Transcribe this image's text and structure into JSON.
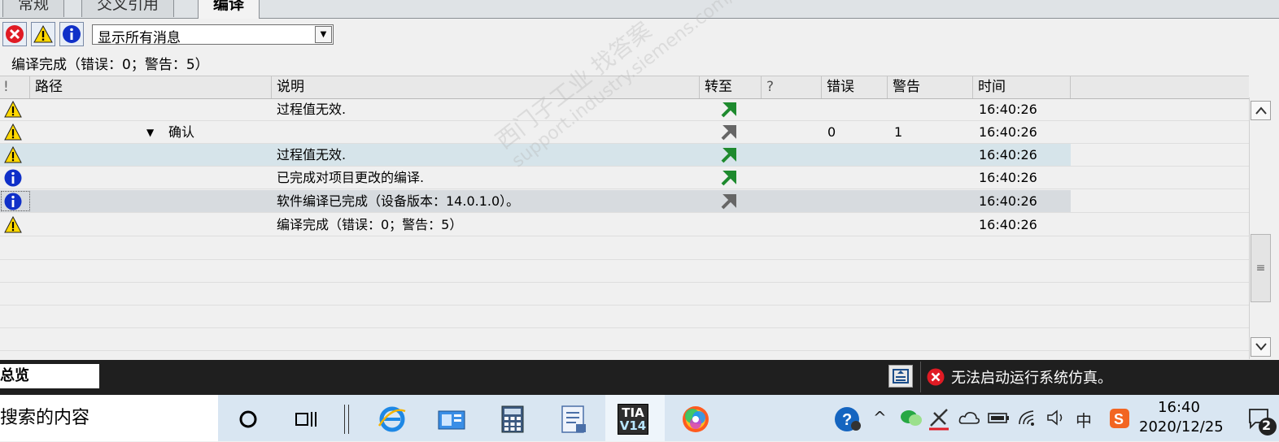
{
  "tabs": [
    {
      "label": "常规"
    },
    {
      "label": "交叉引用"
    },
    {
      "label": "编译"
    }
  ],
  "filter": {
    "selected": "显示所有消息"
  },
  "summary": "编译完成（错误：0；警告：5）",
  "columns": {
    "flag": "!",
    "path": "路径",
    "desc": "说明",
    "goto": "转至",
    "q": "?",
    "errors": "错误",
    "warnings": "警告",
    "time": "时间"
  },
  "rows": [
    {
      "icon": "warning-icon",
      "path": "",
      "desc": "过程值无效.",
      "goto": "green",
      "errors": "",
      "warnings": "",
      "time": "16:40:26"
    },
    {
      "icon": "warning-icon",
      "path": "确认",
      "desc": "",
      "goto": "gray",
      "errors": "0",
      "warnings": "1",
      "time": "16:40:26"
    },
    {
      "icon": "warning-icon",
      "path": "",
      "desc": "过程值无效.",
      "goto": "green",
      "errors": "",
      "warnings": "",
      "time": "16:40:26"
    },
    {
      "icon": "info-icon",
      "path": "",
      "desc": "已完成对项目更改的编译.",
      "goto": "green",
      "errors": "",
      "warnings": "",
      "time": "16:40:26"
    },
    {
      "icon": "info-icon",
      "path": "",
      "desc": "软件编译已完成（设备版本：14.0.1.0）。",
      "goto": "gray",
      "errors": "",
      "warnings": "",
      "time": "16:40:26"
    },
    {
      "icon": "warning-icon",
      "path": "",
      "desc": "编译完成（错误：0；警告：5）",
      "goto": "",
      "errors": "",
      "warnings": "",
      "time": "16:40:26"
    }
  ],
  "watermark": {
    "line1": "西门子工业 找答案",
    "line2": "support.industry.siemens.com/cs"
  },
  "statusbar": {
    "overview": "总览",
    "message": "无法启动运行系统仿真。"
  },
  "taskbar": {
    "search": "搜索的内容",
    "tia": "TIA\nV14",
    "tray_lang": "中",
    "time": "16:40",
    "date": "2020/12/25",
    "notif_count": "2"
  },
  "colors": {
    "accent_green": "#1e8a2e",
    "warning_yellow": "#ffd800",
    "info_blue": "#1030c8",
    "error_red": "#e01b24"
  }
}
